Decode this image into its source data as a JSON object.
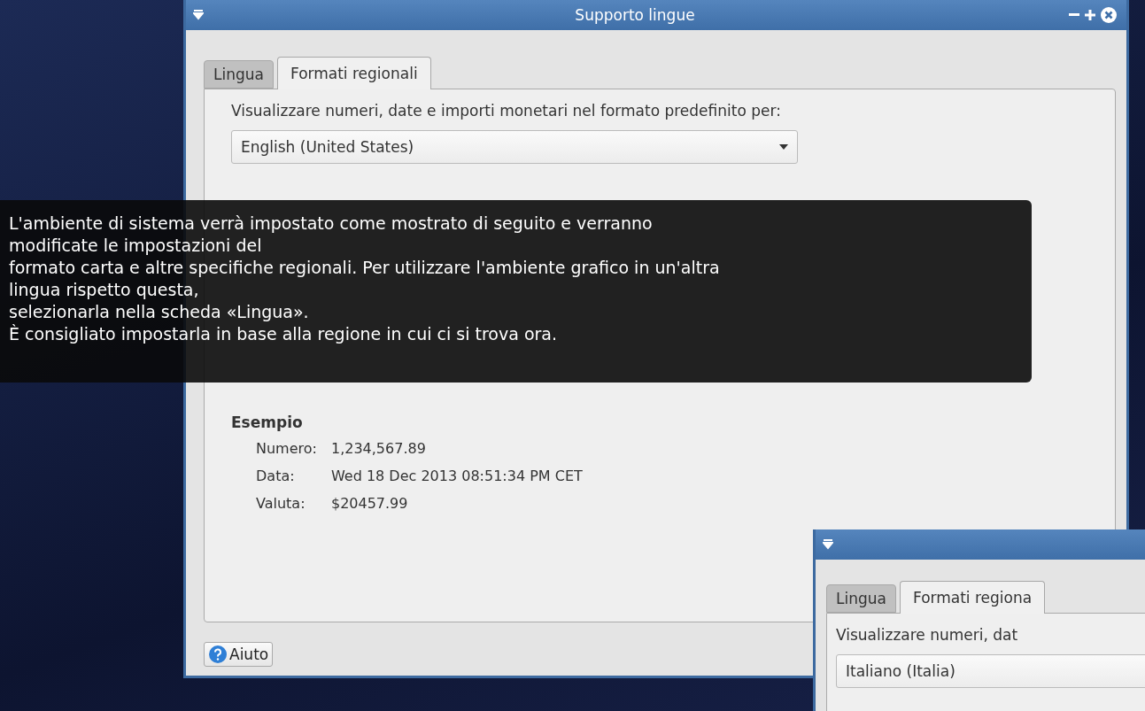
{
  "main_window": {
    "title": "Supporto lingue",
    "tabs": [
      {
        "label": "Lingua",
        "selected": false
      },
      {
        "label": "Formati regionali",
        "selected": true
      }
    ],
    "prompt": "Visualizzare numeri, date e importi monetari nel formato predefinito per:",
    "format_dropdown": {
      "value": "English (United States)"
    },
    "example": {
      "heading": "Esempio",
      "rows": [
        {
          "label": "Numero:",
          "value": "1,234,567.89"
        },
        {
          "label": "Data:",
          "value": "Wed 18 Dec 2013 08:51:34 PM CET"
        },
        {
          "label": "Valuta:",
          "value": "$20457.99"
        }
      ]
    },
    "help_button": "Aiuto"
  },
  "tooltip": {
    "lines": [
      "L'ambiente di sistema verrà impostato come mostrato di seguito e verranno",
      "modificate le impostazioni del",
      "formato carta e altre specifiche regionali. Per utilizzare l'ambiente grafico in un'altra",
      "lingua rispetto questa,",
      "selezionarla nella scheda «Lingua».",
      "È consigliato impostarla in base alla regione in cui ci si trova ora."
    ]
  },
  "second_window": {
    "tabs": [
      {
        "label": "Lingua",
        "selected": false
      },
      {
        "label": "Formati regiona",
        "selected": true
      }
    ],
    "prompt": "Visualizzare numeri, dat",
    "format_dropdown": {
      "value": "Italiano (Italia)"
    }
  }
}
